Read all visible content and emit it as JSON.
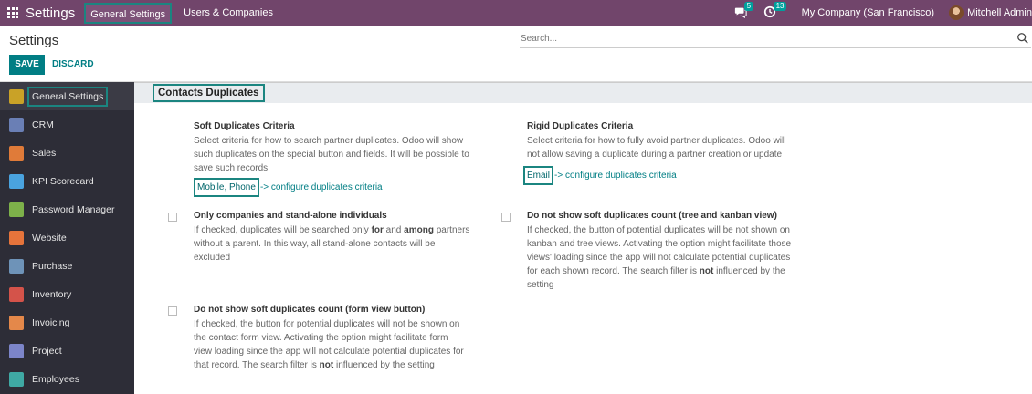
{
  "navbar": {
    "app_title": "Settings",
    "menu": [
      "General Settings",
      "Users & Companies"
    ],
    "messages_count": "5",
    "activities_count": "13",
    "company": "My Company (San Francisco)",
    "user": "Mitchell Admin"
  },
  "control": {
    "title": "Settings",
    "search_placeholder": "Search...",
    "save_label": "SAVE",
    "discard_label": "DISCARD"
  },
  "sidebar": {
    "items": [
      {
        "label": "General Settings",
        "icon": "settings-icon",
        "color": "#c9a227"
      },
      {
        "label": "CRM",
        "icon": "crm-icon",
        "color": "#6a7fb5"
      },
      {
        "label": "Sales",
        "icon": "sales-icon",
        "color": "#e07b39"
      },
      {
        "label": "KPI Scorecard",
        "icon": "kpi-icon",
        "color": "#4aa3df"
      },
      {
        "label": "Password Manager",
        "icon": "password-manager-icon",
        "color": "#7db14a"
      },
      {
        "label": "Website",
        "icon": "website-icon",
        "color": "#e6743b"
      },
      {
        "label": "Purchase",
        "icon": "purchase-icon",
        "color": "#6e93b8"
      },
      {
        "label": "Inventory",
        "icon": "inventory-icon",
        "color": "#d4534a"
      },
      {
        "label": "Invoicing",
        "icon": "invoicing-icon",
        "color": "#e4884a"
      },
      {
        "label": "Project",
        "icon": "project-icon",
        "color": "#7c85c9"
      },
      {
        "label": "Employees",
        "icon": "employees-icon",
        "color": "#3fa9a4"
      }
    ]
  },
  "section": {
    "title": "Contacts Duplicates",
    "soft": {
      "title": "Soft Duplicates Criteria",
      "desc_lines": [
        "Select criteria for how to search partner duplicates. Odoo will show",
        "such duplicates on the special button and fields. It will be possible to",
        "save such records"
      ],
      "criteria": "Mobile, Phone",
      "link": "-> configure duplicates criteria"
    },
    "rigid": {
      "title": "Rigid Duplicates Criteria",
      "desc_lines": [
        "Select criteria for how to fully avoid partner duplicates. Odoo will",
        "not allow saving a duplicate during a partner creation or update"
      ],
      "criteria": "Email",
      "link": "-> configure duplicates criteria"
    },
    "standalone": {
      "title": "Only companies and stand-alone individuals",
      "line1_a": "If checked, duplicates will be searched only ",
      "line1_b": "for",
      "line1_c": " and ",
      "line1_d": "among",
      "line1_e": " partners",
      "line2": "without a parent. In this way, all stand-alone contacts will be",
      "line3": "excluded"
    },
    "tree_kanban": {
      "title": "Do not show soft duplicates count (tree and kanban view)",
      "line1": "If checked, the button of potential duplicates will be not shown on",
      "line2": "kanban and tree views. Activating the option might facilitate those",
      "line3": "views' loading since the app will not calculate potential duplicates",
      "line4_a": "for each shown record. The search filter is ",
      "line4_b": "not",
      "line4_c": " influenced by the",
      "line5": "setting"
    },
    "form_view": {
      "title": "Do not show soft duplicates count (form view button)",
      "line1": "If checked, the button for potential duplicates will not be shown on",
      "line2": "the contact form view. Activating the option might facilitate form",
      "line3": "view loading since the app will not calculate potential duplicates for",
      "line4_a": "that record. The search filter is ",
      "line4_b": "not",
      "line4_c": " influenced by the setting"
    }
  }
}
